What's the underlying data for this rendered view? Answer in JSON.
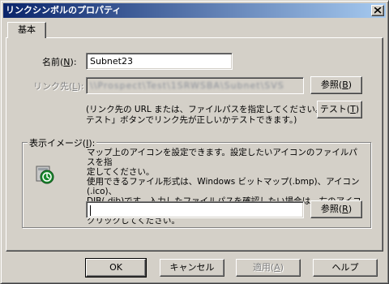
{
  "title": "リンクシンボルのプロパティ",
  "tab": "基本",
  "name_label": "名前(",
  "name_key": "N",
  "name_label_end": "):",
  "name_value": "Subnet23",
  "link_label": "リンク先(",
  "link_key": "L",
  "link_label_end": "):",
  "link_value": "\\\\Prospect\\Test\\1SRWSBA\\Subnet\\SVS",
  "browse1_label": "参照(",
  "browse1_key": "B",
  "browse1_end": ")",
  "hint_line1": "(リンク先の URL または、ファイルパスを指定してください。「",
  "hint_line2": "テスト」ボタンでリンク先が正しいかテストできます。)",
  "test_label": "テスト(",
  "test_key": "T",
  "test_end": ")",
  "image_label": "表示イメージ(",
  "image_key": "I",
  "image_end": "):",
  "desc_line1": "マップ上のアイコンを設定できます。設定したいアイコンのファイルパスを指",
  "desc_line2": "定してください。",
  "desc_line3": "使用できるファイル形式は、Windows ビットマップ(.bmp)、アイコン(.ico)、",
  "desc_line4": "DIB(.dib)です。入力したファイルパスを確認したい場合は、左のアイコンを",
  "desc_line5": "クリックしてください。",
  "image_path_value": "",
  "browse2_label": "参照(",
  "browse2_key": "R",
  "browse2_end": ")",
  "ok_label": "OK",
  "cancel_label": "キャンセル",
  "apply_label": "適用(",
  "apply_key": "A",
  "apply_end": ")",
  "help_label": "ヘルプ",
  "icon_name": "link-symbol-icon",
  "colors": {
    "face": "#d4d0c8",
    "title_start": "#0a246a",
    "title_end": "#a6caf0",
    "icon_green": "#1a8a2e"
  }
}
